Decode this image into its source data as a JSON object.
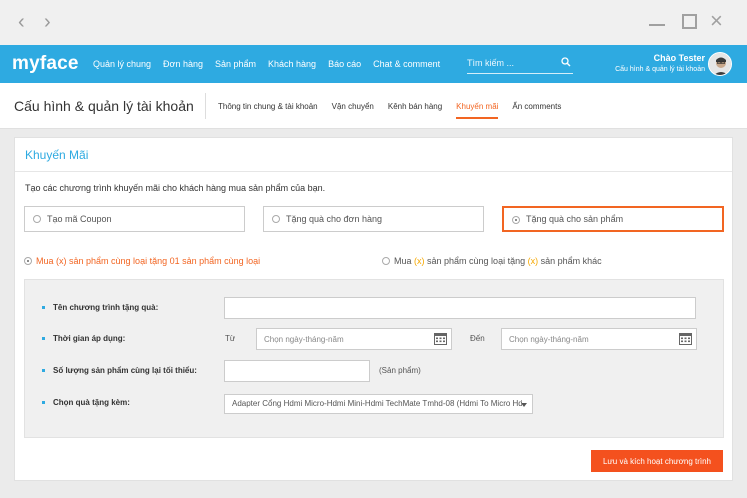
{
  "nav": {
    "back_glyph": "‹",
    "forward_glyph": "›"
  },
  "window_controls": {
    "close_glyph": "×"
  },
  "topbar": {
    "logo": "myface",
    "menu": [
      "Quản lý chung",
      "Đơn hàng",
      "Sản phẩm",
      "Khách hàng",
      "Báo cáo",
      "Chat & comment"
    ],
    "search_placeholder": "Tìm kiếm ...",
    "greeting": "Chào Tester",
    "account_link": "Cấu hình & quản lý tài khoản",
    "accent_color": "#2eaae1"
  },
  "subheader": {
    "title": "Cấu hình & quản lý tài khoản",
    "tabs": [
      "Thông tin chung & tài khoản",
      "Vận chuyển",
      "Kênh bán hàng",
      "Khuyến mãi",
      "Ẩn comments"
    ],
    "active_tab": "Khuyến mãi"
  },
  "card": {
    "title": "Khuyến Mãi",
    "description": "Tạo các chương trình khuyến mãi cho khách hàng mua sản phẩm của bạn.",
    "options": [
      "Tạo mã Coupon",
      "Tặng quà cho đơn hàng",
      "Tặng quà cho sản phẩm"
    ],
    "selected_option": "Tặng quà cho sản phẩm",
    "sub_options": {
      "a_pre": "Mua ",
      "a_x": "(x)",
      "a_post": " sản phẩm cùng loại tặng 01 sản phẩm cùng loại",
      "b_pre": "Mua ",
      "b_x1": "(x)",
      "b_mid": " sản phẩm cùng loại tặng ",
      "b_x2": "(x)",
      "b_post": " sản phẩm khác"
    },
    "form": {
      "program_name_label": "Tên chương trình tặng quà:",
      "program_name_value": "",
      "period_label": "Thời gian áp dụng:",
      "from_label": "Từ",
      "to_label": "Đến",
      "date_placeholder": "Chọn ngày-tháng-năm",
      "min_qty_label": "Số lượng sản phẩm cùng lại tối thiểu:",
      "min_qty_unit": "(Sản phẩm)",
      "gift_label": "Chọn quà tặng kèm:",
      "gift_selected": "Adapter Cổng Hdmi Micro-Hdmi Mini-Hdmi TechMate Tmhd-08 (Hdmi To Micro Hdmi)"
    },
    "save_button": "Lưu và kích hoạt chương trình",
    "accent_orange": "#f26522"
  }
}
